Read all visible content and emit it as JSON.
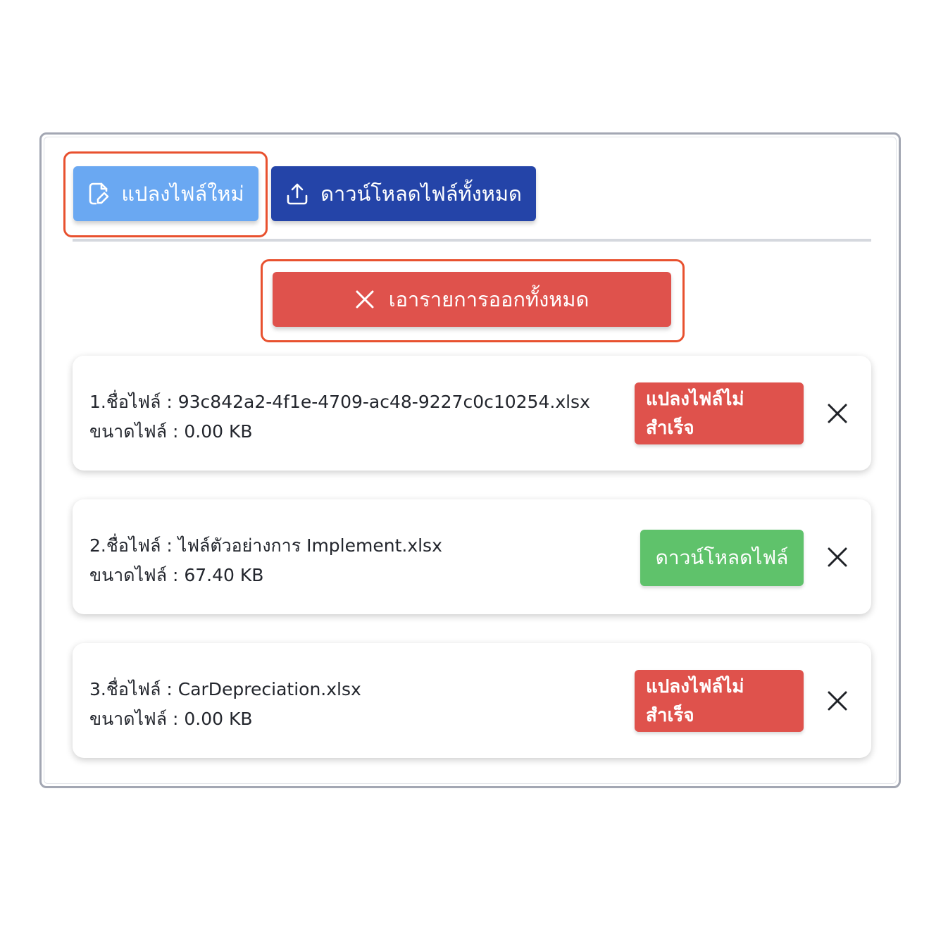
{
  "toolbar": {
    "new_convert_label": "แปลงไฟล์ใหม่",
    "download_all_label": "ดาวน์โหลดไฟล์ทั้งหมด",
    "clear_all_label": "เอารายการออกทั้งหมด"
  },
  "files": [
    {
      "name_line": "1.ชื่อไฟล์ : 93c842a2-4f1e-4709-ac48-9227c0c10254.xlsx",
      "size_line": "ขนาดไฟล์ : 0.00 KB",
      "status_label": "แปลงไฟล์ไม่สำเร็จ",
      "status": "failed"
    },
    {
      "name_line": "2.ชื่อไฟล์ : ไฟล์ตัวอย่างการ Implement.xlsx",
      "size_line": "ขนาดไฟล์ : 67.40 KB",
      "status_label": "ดาวน์โหลดไฟล์",
      "status": "success"
    },
    {
      "name_line": "3.ชื่อไฟล์ : CarDepreciation.xlsx",
      "size_line": "ขนาดไฟล์ : 0.00 KB",
      "status_label": "แปลงไฟล์ไม่สำเร็จ",
      "status": "failed"
    }
  ],
  "colors": {
    "new_convert": "#6aa8f2",
    "download_all": "#2444a8",
    "danger": "#df524c",
    "success": "#5fc26b",
    "highlight": "#e8512f"
  },
  "icons": {
    "new_convert": "edit-file-icon",
    "download_all": "upload-icon",
    "clear_all": "close-icon",
    "remove_item": "close-icon"
  }
}
